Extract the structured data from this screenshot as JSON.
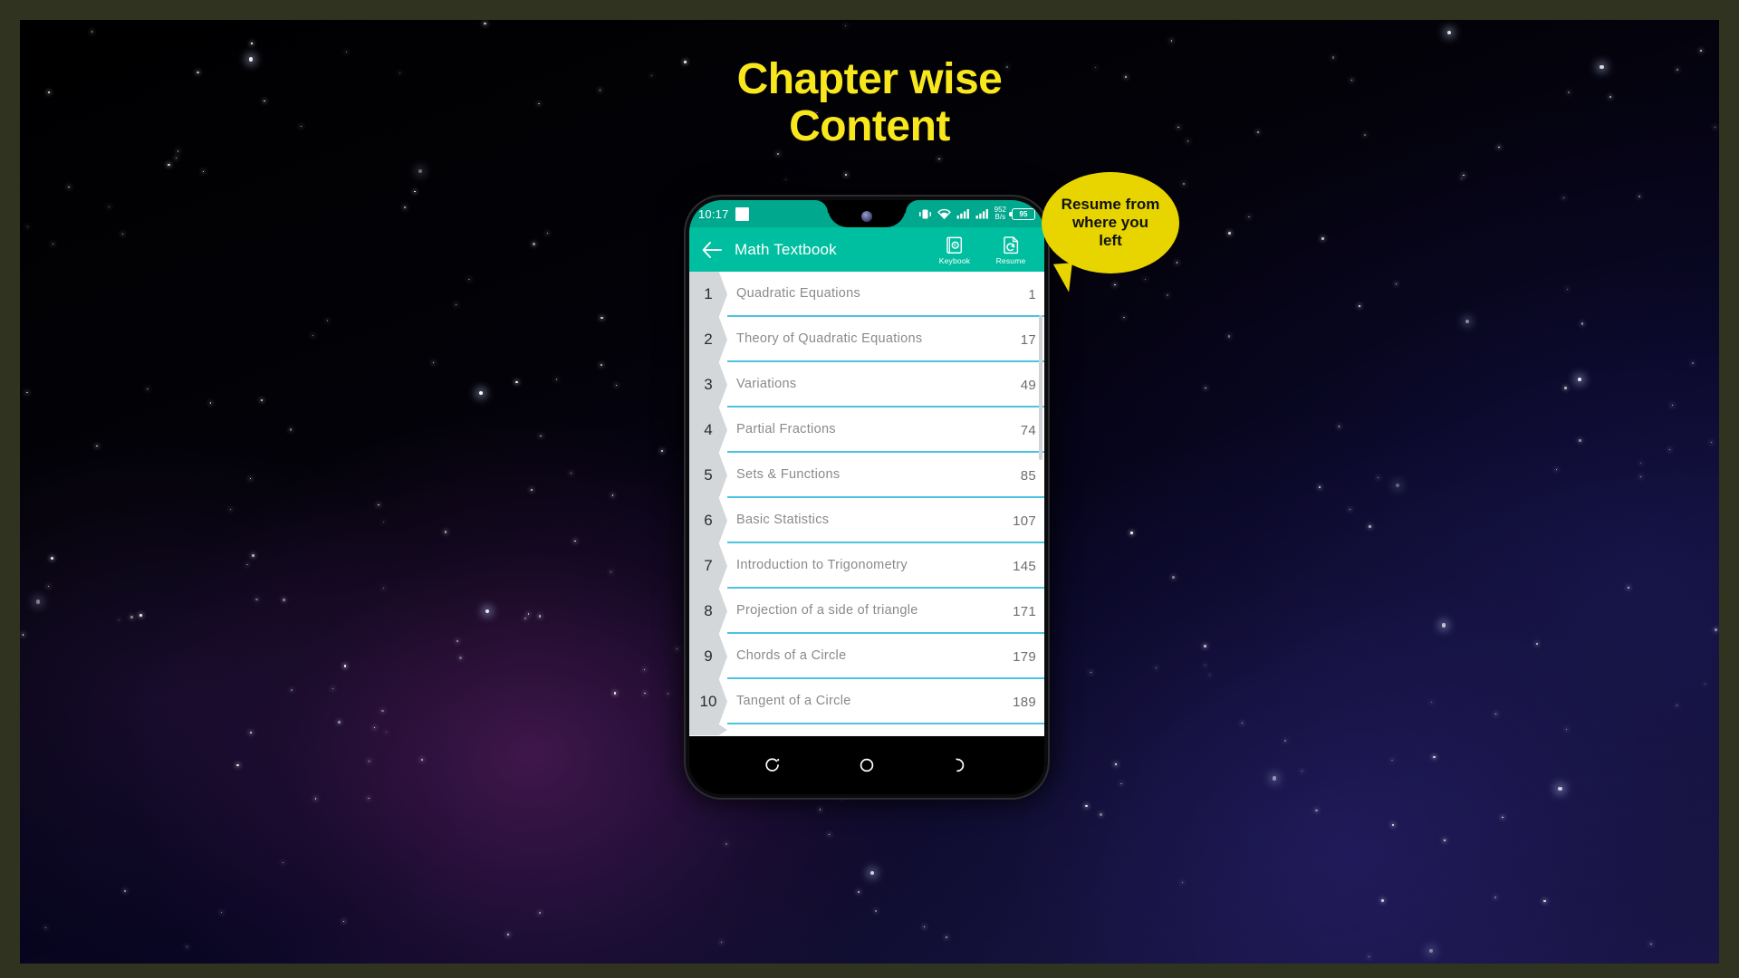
{
  "headline": "Chapter wise\nContent",
  "colors": {
    "headline_yellow": "#f8e71c",
    "appbar_teal": "#00bfa0",
    "statusbar_teal": "#00a98d",
    "divider_cyan": "#4cc3e0",
    "number_tag_gray": "#d3d7d9",
    "callout_yellow": "#e8d500",
    "frame_olive": "#30331f"
  },
  "callout": {
    "text": "Resume from\nwhere you\nleft"
  },
  "phone": {
    "statusbar": {
      "clock": "10:17",
      "notification_badge": "notification-chip",
      "icons": [
        "vibrate-icon",
        "wifi-icon",
        "signal-bars-icon",
        "signal-bars-icon"
      ],
      "net_rate_value": "952",
      "net_rate_unit": "B/s",
      "battery_level": "95"
    },
    "appbar": {
      "back_icon": "back-arrow-icon",
      "title": "Math Textbook",
      "actions": [
        {
          "icon": "keybook-icon",
          "label": "Keybook"
        },
        {
          "icon": "resume-icon",
          "label": "Resume"
        }
      ]
    },
    "list": {
      "columns": [
        "number",
        "title",
        "page"
      ],
      "chapters": [
        {
          "number": "1",
          "title": "Quadratic Equations",
          "page": "1"
        },
        {
          "number": "2",
          "title": "Theory of Quadratic Equations",
          "page": "17"
        },
        {
          "number": "3",
          "title": "Variations",
          "page": "49"
        },
        {
          "number": "4",
          "title": "Partial Fractions",
          "page": "74"
        },
        {
          "number": "5",
          "title": "Sets & Functions",
          "page": "85"
        },
        {
          "number": "6",
          "title": "Basic Statistics",
          "page": "107"
        },
        {
          "number": "7",
          "title": "Introduction to Trigonometry",
          "page": "145"
        },
        {
          "number": "8",
          "title": "Projection of a side of triangle",
          "page": "171"
        },
        {
          "number": "9",
          "title": "Chords of a Circle",
          "page": "179"
        },
        {
          "number": "10",
          "title": "Tangent of a Circle",
          "page": "189"
        }
      ]
    },
    "navbar": {
      "buttons": [
        {
          "icon": "recents-icon"
        },
        {
          "icon": "home-icon"
        },
        {
          "icon": "back-nav-icon"
        }
      ]
    }
  }
}
